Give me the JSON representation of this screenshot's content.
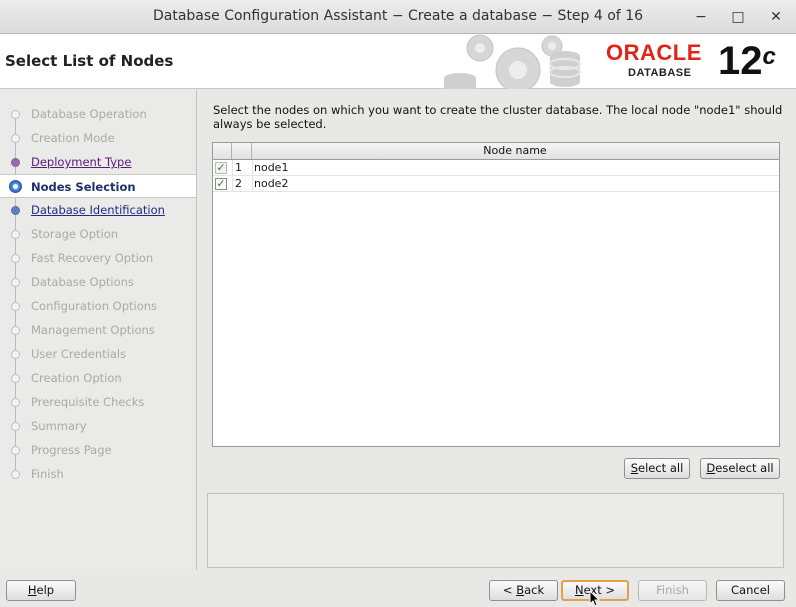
{
  "window": {
    "title": "Database Configuration Assistant − Create a database − Step 4 of 16",
    "minimize_glyph": "−",
    "maximize_glyph": "□",
    "close_glyph": "✕"
  },
  "banner": {
    "heading": "Select List of Nodes",
    "brand": "ORACLE",
    "brand_sub": "DATABASE",
    "version": "12",
    "version_suffix": "c",
    "brand_color": "#e2231a"
  },
  "nav": {
    "items": [
      {
        "label": "Database Operation",
        "state": "disabled"
      },
      {
        "label": "Creation Mode",
        "state": "disabled"
      },
      {
        "label": "Deployment Type",
        "state": "visited"
      },
      {
        "label": "Nodes Selection",
        "state": "current"
      },
      {
        "label": "Database Identification",
        "state": "link"
      },
      {
        "label": "Storage Option",
        "state": "disabled"
      },
      {
        "label": "Fast Recovery Option",
        "state": "disabled"
      },
      {
        "label": "Database Options",
        "state": "disabled"
      },
      {
        "label": "Configuration Options",
        "state": "disabled"
      },
      {
        "label": "Management Options",
        "state": "disabled"
      },
      {
        "label": "User Credentials",
        "state": "disabled"
      },
      {
        "label": "Creation Option",
        "state": "disabled"
      },
      {
        "label": "Prerequisite Checks",
        "state": "disabled"
      },
      {
        "label": "Summary",
        "state": "disabled"
      },
      {
        "label": "Progress Page",
        "state": "disabled"
      },
      {
        "label": "Finish",
        "state": "disabled"
      }
    ]
  },
  "main": {
    "description": "Select the nodes on which you want to create the cluster database. The local node \"node1\" should always be selected.",
    "table": {
      "column_header": "Node name",
      "rows": [
        {
          "index": "1",
          "name": "node1",
          "checked": true,
          "disabled": true
        },
        {
          "index": "2",
          "name": "node2",
          "checked": true,
          "disabled": false
        }
      ]
    },
    "select_all_label_u": "S",
    "select_all_label_rest": "elect all",
    "deselect_all_label_u": "D",
    "deselect_all_label_rest": "eselect all"
  },
  "footer": {
    "help_u": "H",
    "help_rest": "elp",
    "back_pre": "< ",
    "back_u": "B",
    "back_rest": "ack",
    "next_u": "N",
    "next_rest": "ext >",
    "finish_label": "Finish",
    "cancel_label": "Cancel"
  }
}
